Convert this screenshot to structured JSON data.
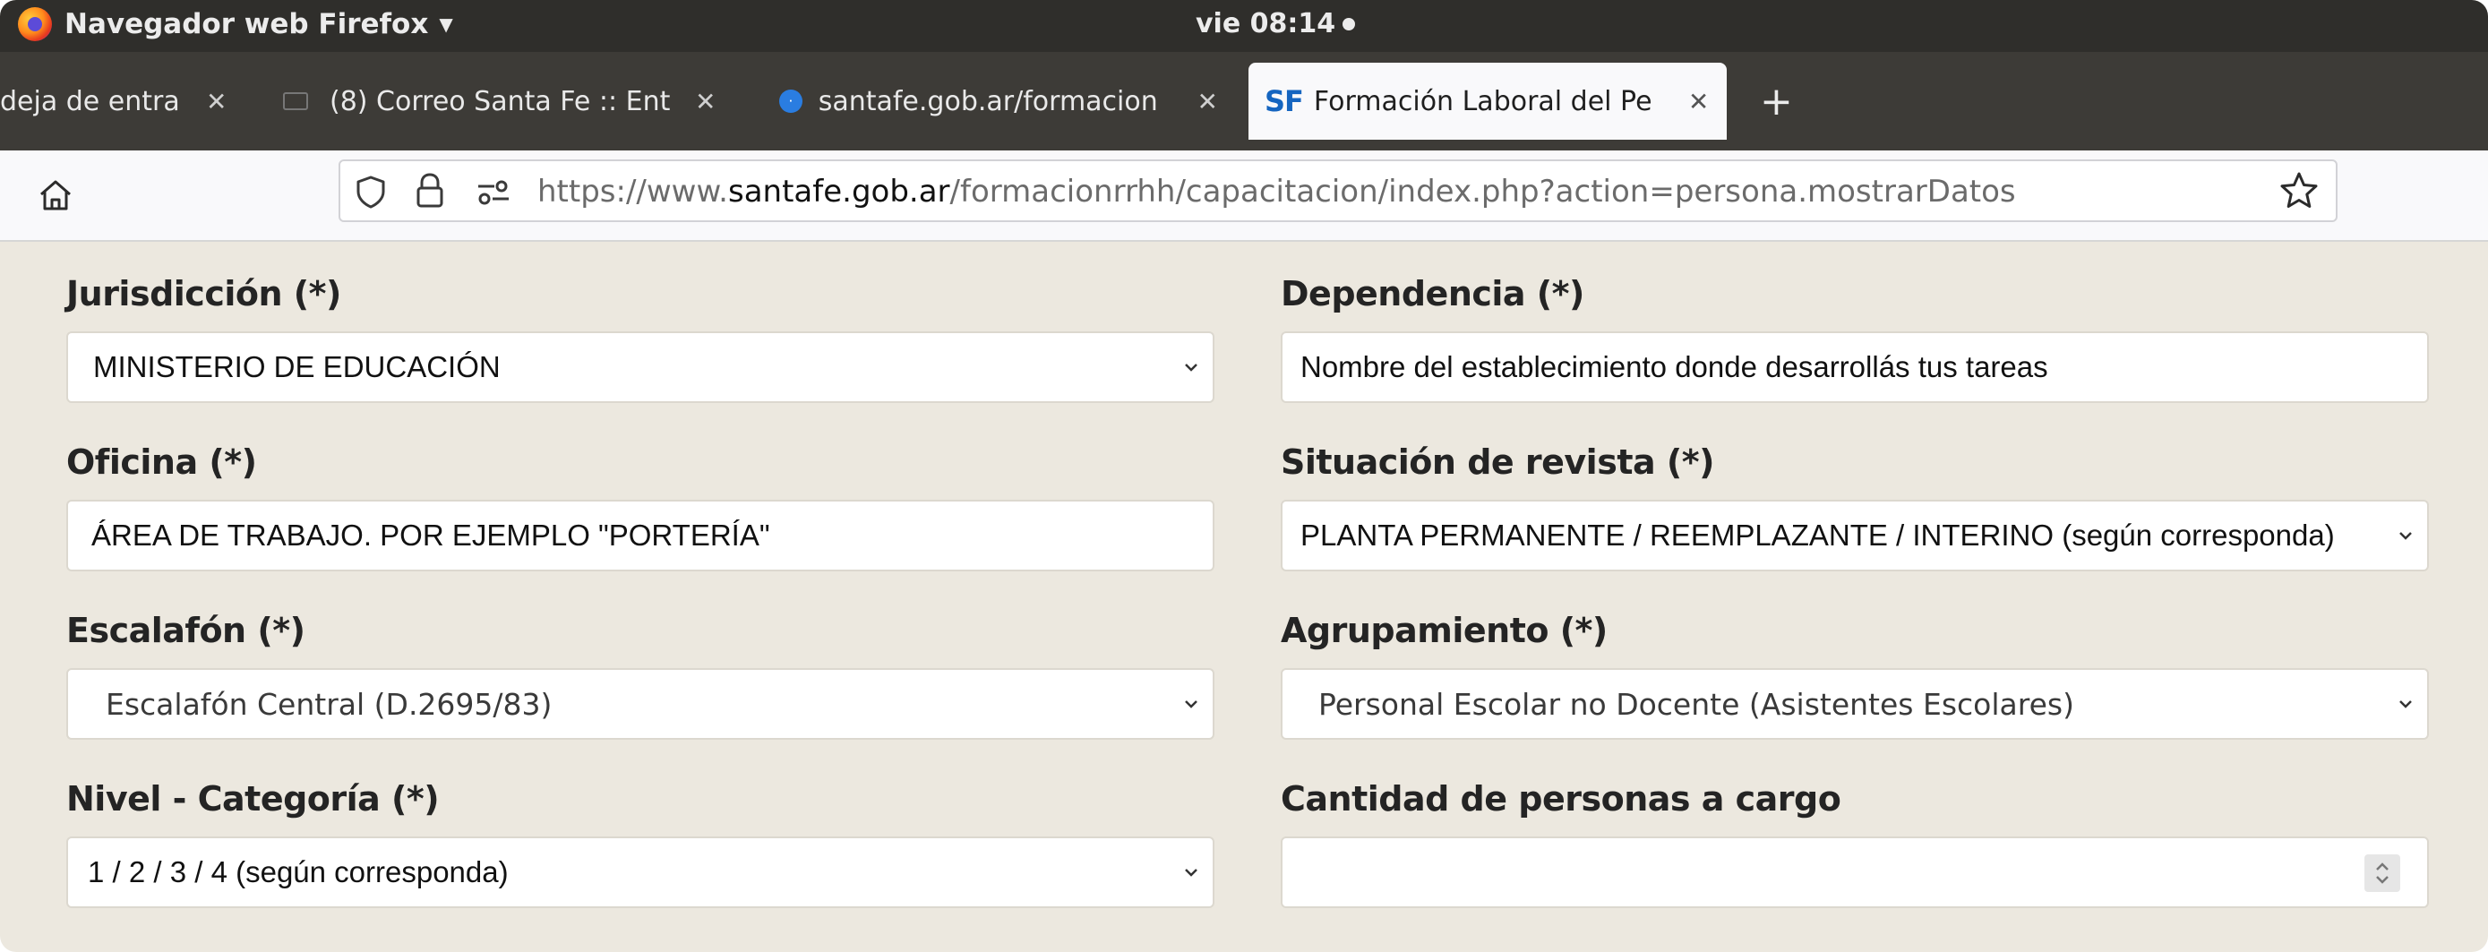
{
  "system": {
    "app_name": "Navegador web Firefox",
    "clock": "vie 08:14"
  },
  "tabs": [
    {
      "label": "deja de entra"
    },
    {
      "label": "(8) Correo Santa Fe :: Ent"
    },
    {
      "label": "santafe.gob.ar/formacion"
    },
    {
      "label": "Formación Laboral del Pe",
      "favicon_text": "SF",
      "active": true
    }
  ],
  "new_tab_label": "+",
  "address_bar": {
    "url_prefix": "https://www.",
    "url_host": "santafe.gob.ar",
    "url_path": "/formacionrrhh/capacitacion/index.php?action=persona.mostrarDatos"
  },
  "form": {
    "jurisdiccion": {
      "label": "Jurisdicción (*)",
      "value": "MINISTERIO DE EDUCACIÓN"
    },
    "dependencia": {
      "label": "Dependencia (*)",
      "value": "Nombre del establecimiento donde desarrollás tus tareas"
    },
    "oficina": {
      "label": "Oficina (*)",
      "value": "ÁREA DE TRABAJO. POR EJEMPLO \"PORTERÍA\""
    },
    "situacion": {
      "label": "Situación de revista (*)",
      "value": "PLANTA PERMANENTE / REEMPLAZANTE / INTERINO (según corresponda)"
    },
    "escalafon": {
      "label": "Escalafón (*)",
      "value": "Escalafón Central (D.2695/83)"
    },
    "agrupamiento": {
      "label": "Agrupamiento (*)",
      "value": "Personal Escolar no Docente (Asistentes Escolares)"
    },
    "nivel": {
      "label": "Nivel - Categoría (*)",
      "value": "1 / 2 / 3 / 4 (según corresponda)"
    },
    "personas_cargo": {
      "label": "Cantidad de personas a cargo",
      "value": ""
    }
  },
  "colors": {
    "topbar": "#2f2e2b",
    "tabstrip": "#3d3b37",
    "page_background": "#ece8df",
    "active_tab": "#f9f9fb",
    "favicon_sf": "#1565c0"
  }
}
